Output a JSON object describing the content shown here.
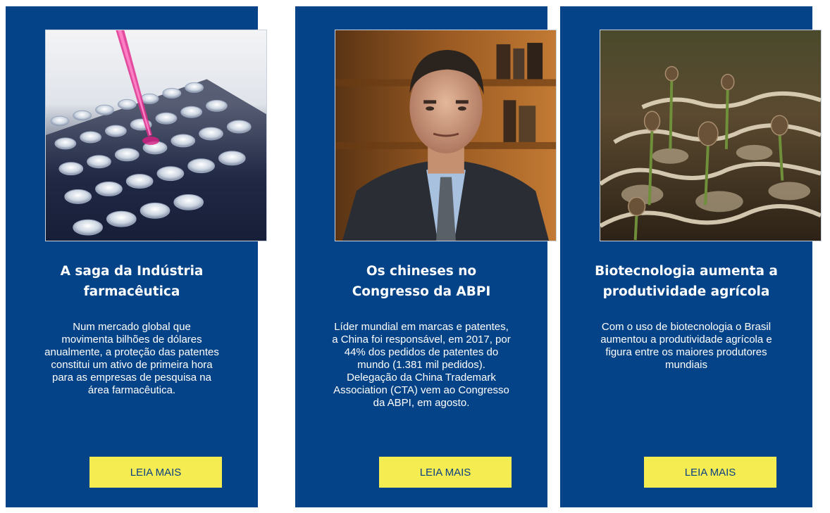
{
  "cards": [
    {
      "title_line1": "A saga da Indústria",
      "title_line2": "farmacêutica",
      "text": "Num mercado global que\nmovimenta bilhões de dólares\nanualmente, a proteção das patentes\nconstitui um ativo de primeira hora\npara as empresas de pesquisa na\nárea farmacêutica.",
      "button_label": "LEIA MAIS",
      "image_subject": "laboratory-test-tubes-pipette"
    },
    {
      "title_line1": "Os chineses no",
      "title_line2": "Congresso da ABPI",
      "text": "Líder mundial em marcas e patentes,\na China foi responsável, em 2017, por\n44% dos pedidos de patentes do\nmundo (1.381 mil pedidos).\nDelegação da China Trademark\nAssociation (CTA) vem ao Congresso\nda ABPI, em agosto.",
      "button_label": "LEIA MAIS",
      "image_subject": "portrait-man-in-suit"
    },
    {
      "title_line1": "Biotecnologia aumenta a",
      "title_line2": "produtividade agrícola",
      "text": "Com o uso de biotecnologia o Brasil\naumentou a produtividade agrícola e\nfigura entre os maiores produtores\nmundiais",
      "button_label": "LEIA MAIS",
      "image_subject": "coffee-seedlings-sprouting"
    }
  ],
  "colors": {
    "card_background": "#044387",
    "button_background": "#f5ec52",
    "button_text": "#0a3f82",
    "text": "#ffffff"
  }
}
